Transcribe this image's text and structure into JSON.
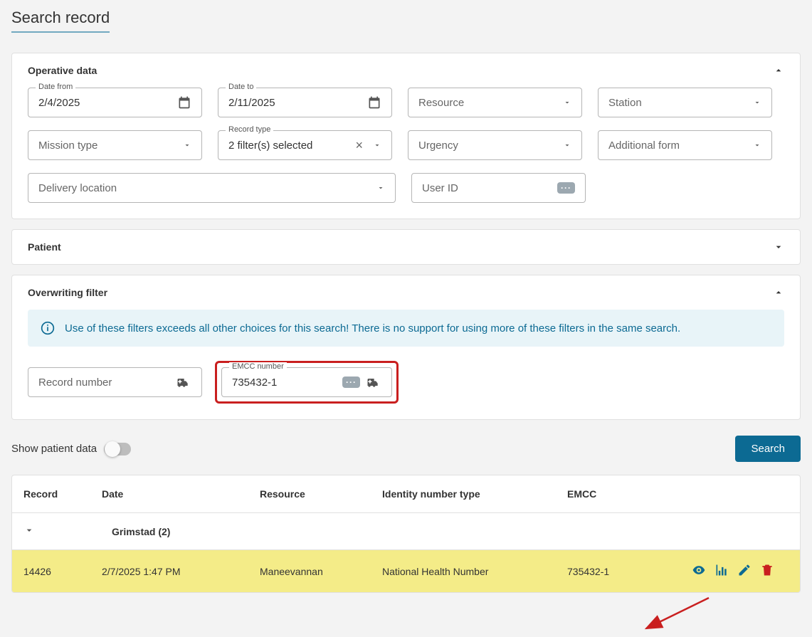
{
  "page": {
    "title": "Search record"
  },
  "operative": {
    "title": "Operative data",
    "date_from": {
      "label": "Date from",
      "value": "2/4/2025"
    },
    "date_to": {
      "label": "Date to",
      "value": "2/11/2025"
    },
    "resource": {
      "placeholder": "Resource"
    },
    "station": {
      "placeholder": "Station"
    },
    "mission_type": {
      "placeholder": "Mission type"
    },
    "record_type": {
      "label": "Record type",
      "value": "2 filter(s) selected"
    },
    "urgency": {
      "placeholder": "Urgency"
    },
    "additional_form": {
      "placeholder": "Additional form"
    },
    "delivery_location": {
      "placeholder": "Delivery location"
    },
    "user_id": {
      "placeholder": "User ID"
    }
  },
  "patient": {
    "title": "Patient"
  },
  "overwriting": {
    "title": "Overwriting filter",
    "info": "Use of these filters exceeds all other choices for this search! There is no support for using more of these filters in the same search.",
    "record_number": {
      "placeholder": "Record number"
    },
    "emcc_number": {
      "label": "EMCC number",
      "value": "735432-1"
    }
  },
  "toggle": {
    "label": "Show patient data"
  },
  "search_button": "Search",
  "table": {
    "headers": {
      "record": "Record",
      "date": "Date",
      "resource": "Resource",
      "identity": "Identity number type",
      "emcc": "EMCC"
    },
    "group": {
      "label": "Grimstad (2)"
    },
    "rows": [
      {
        "record": "14426",
        "date": "2/7/2025 1:47 PM",
        "resource": "Maneevannan",
        "identity": "National Health Number",
        "emcc": "735432-1"
      }
    ]
  },
  "colors": {
    "accent": "#0c6a93",
    "highlight_row": "#f4ec88",
    "highlight_border": "#c91f1f"
  }
}
